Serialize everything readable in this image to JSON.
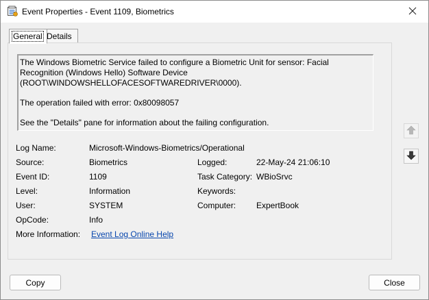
{
  "window": {
    "title": "Event Properties - Event 1109, Biometrics"
  },
  "tabs": [
    {
      "label": "General",
      "active": true
    },
    {
      "label": "Details",
      "active": false
    }
  ],
  "description": {
    "line1": "The Windows Biometric Service failed to configure a Biometric Unit for sensor: Facial Recognition (Windows Hello) Software Device (ROOT\\WINDOWSHELLOFACESOFTWAREDRIVER\\0000).",
    "line2": "The operation failed with error: 0x80098057",
    "line3": "See the \"Details\" pane for information about the failing configuration."
  },
  "fields": {
    "log_name": {
      "label": "Log Name:",
      "value": "Microsoft-Windows-Biometrics/Operational"
    },
    "source": {
      "label": "Source:",
      "value": "Biometrics"
    },
    "event_id": {
      "label": "Event ID:",
      "value": "1109"
    },
    "level": {
      "label": "Level:",
      "value": "Information"
    },
    "user": {
      "label": "User:",
      "value": "SYSTEM"
    },
    "opcode": {
      "label": "OpCode:",
      "value": "Info"
    },
    "more_info": {
      "label": "More Information:",
      "link": "Event Log Online Help"
    },
    "logged": {
      "label": "Logged:",
      "value": "22-May-24 21:06:10"
    },
    "task_category": {
      "label": "Task Category:",
      "value": "WBioSrvc"
    },
    "keywords": {
      "label": "Keywords:",
      "value": ""
    },
    "computer": {
      "label": "Computer:",
      "value": "ExpertBook"
    }
  },
  "buttons": {
    "copy": "Copy",
    "close": "Close"
  },
  "icons": {
    "title": "event-viewer-icon",
    "close": "close-icon",
    "up": "arrow-up-icon",
    "down": "arrow-down-icon"
  },
  "colors": {
    "link": "#0645ad",
    "background": "#f0f0f0"
  }
}
